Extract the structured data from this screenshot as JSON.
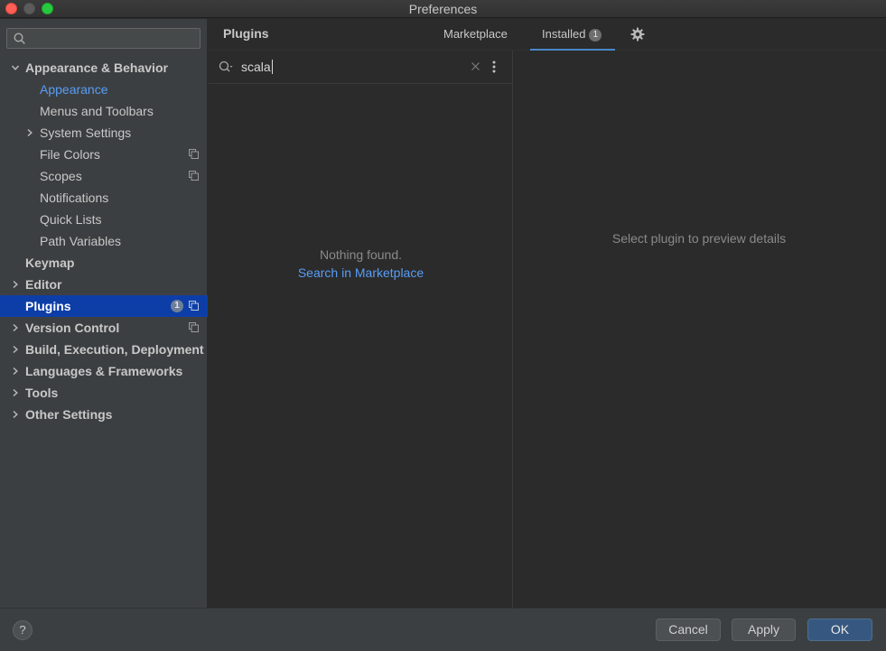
{
  "window": {
    "title": "Preferences"
  },
  "sidebar": {
    "search_placeholder": "",
    "items": [
      {
        "label": "Appearance & Behavior",
        "level": 0,
        "bold": true,
        "arrow": "down"
      },
      {
        "label": "Appearance",
        "level": 1,
        "state": "active-link"
      },
      {
        "label": "Menus and Toolbars",
        "level": 1
      },
      {
        "label": "System Settings",
        "level": 1,
        "arrow": "right"
      },
      {
        "label": "File Colors",
        "level": 1,
        "copy_icon": true
      },
      {
        "label": "Scopes",
        "level": 1,
        "copy_icon": true
      },
      {
        "label": "Notifications",
        "level": 1
      },
      {
        "label": "Quick Lists",
        "level": 1
      },
      {
        "label": "Path Variables",
        "level": 1
      },
      {
        "label": "Keymap",
        "level": 0,
        "bold": true
      },
      {
        "label": "Editor",
        "level": 0,
        "bold": true,
        "arrow": "right"
      },
      {
        "label": "Plugins",
        "level": 0,
        "bold": true,
        "state": "selected",
        "badge": "1",
        "copy_icon": true
      },
      {
        "label": "Version Control",
        "level": 0,
        "bold": true,
        "arrow": "right",
        "copy_icon": true
      },
      {
        "label": "Build, Execution, Deployment",
        "level": 0,
        "bold": true,
        "arrow": "right"
      },
      {
        "label": "Languages & Frameworks",
        "level": 0,
        "bold": true,
        "arrow": "right"
      },
      {
        "label": "Tools",
        "level": 0,
        "bold": true,
        "arrow": "right"
      },
      {
        "label": "Other Settings",
        "level": 0,
        "bold": true,
        "arrow": "right"
      }
    ]
  },
  "header": {
    "title": "Plugins",
    "tabs": [
      {
        "label": "Marketplace",
        "active": false
      },
      {
        "label": "Installed",
        "active": true,
        "badge": "1"
      }
    ]
  },
  "plugin_search": {
    "value": "scala",
    "empty_message": "Nothing found.",
    "marketplace_link": "Search in Marketplace"
  },
  "detail": {
    "hint": "Select plugin to preview details"
  },
  "footer": {
    "help_label": "?",
    "cancel_label": "Cancel",
    "apply_label": "Apply",
    "ok_label": "OK"
  },
  "colors": {
    "accent": "#589df6",
    "selection": "#0d3ea8",
    "tab_underline": "#4a88c7",
    "sidebar_bg": "#3c3f41",
    "content_bg": "#2b2b2b"
  }
}
